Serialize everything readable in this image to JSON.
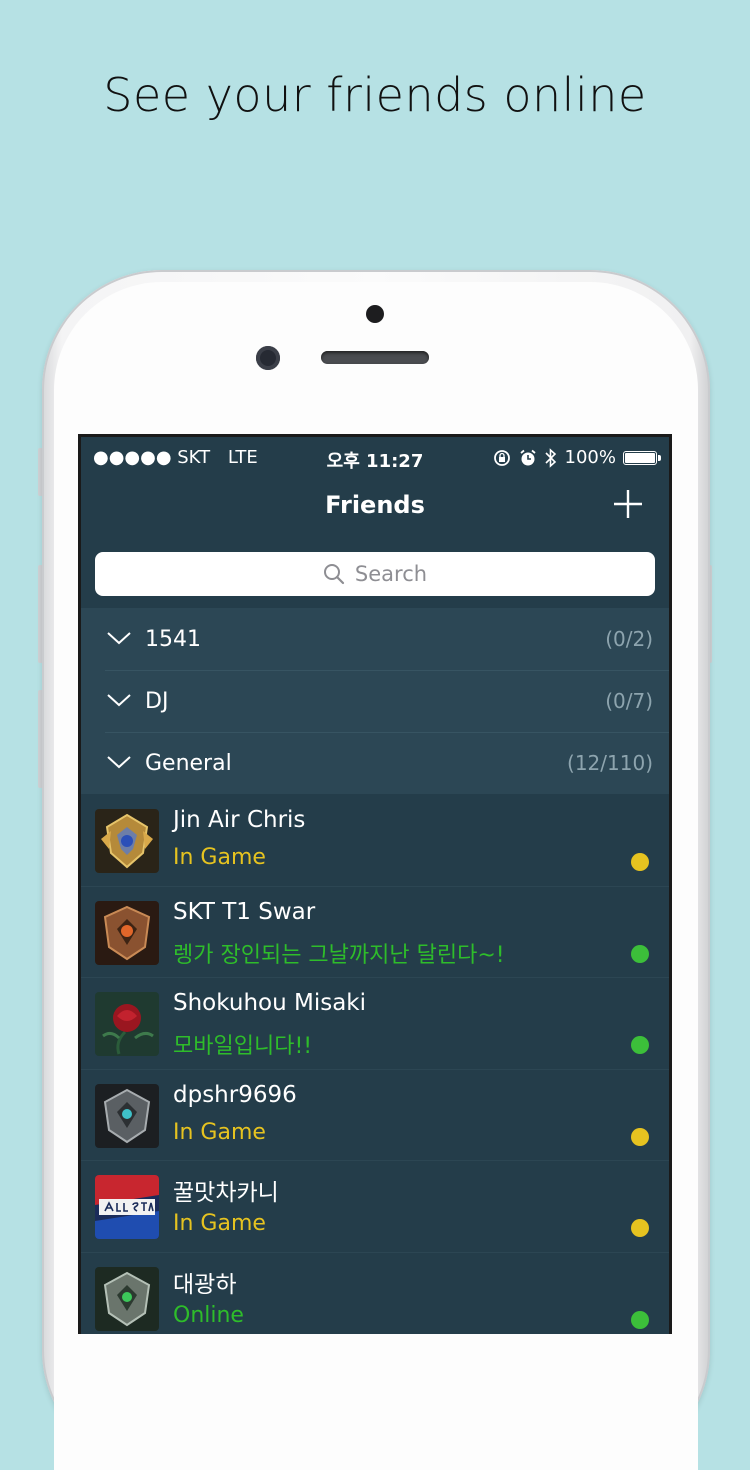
{
  "headline": "See your friends online",
  "statusbar": {
    "carrier": "●●●●● SKT",
    "network": "LTE",
    "time": "오후 11:27",
    "battery": "100%"
  },
  "navbar": {
    "title": "Friends",
    "add_icon": "plus-icon"
  },
  "search": {
    "placeholder": "Search",
    "icon": "search-icon"
  },
  "groups": [
    {
      "name": "1541",
      "count": "(0/2)"
    },
    {
      "name": "DJ",
      "count": "(0/7)"
    },
    {
      "name": "General",
      "count": "(12/110)"
    }
  ],
  "friends": [
    {
      "name": "Jin Air Chris",
      "status": "In Game",
      "status_color": "#e6c320",
      "dot_color": "#e6c320"
    },
    {
      "name": "SKT T1 Swar",
      "status": "렝가 장인되는 그날까지난 달린다~!",
      "status_color": "#2ebd2a",
      "dot_color": "#3cbf3a"
    },
    {
      "name": "Shokuhou Misaki",
      "status": "모바일입니다!!",
      "status_color": "#2ebd2a",
      "dot_color": "#3cbf3a"
    },
    {
      "name": "dpshr9696",
      "status": "In Game",
      "status_color": "#e6c320",
      "dot_color": "#e6c320"
    },
    {
      "name": "꿀맛차카니",
      "status": "In Game",
      "status_color": "#e6c320",
      "dot_color": "#e6c320"
    },
    {
      "name": "대광하",
      "status": "Online",
      "status_color": "#2ebd2a",
      "dot_color": "#3cbf3a"
    }
  ],
  "colors": {
    "background": "#b6e1e4",
    "screen": "#243d4a",
    "group_bg": "#2c4755",
    "in_game": "#e6c320",
    "online": "#3cbf3a"
  }
}
